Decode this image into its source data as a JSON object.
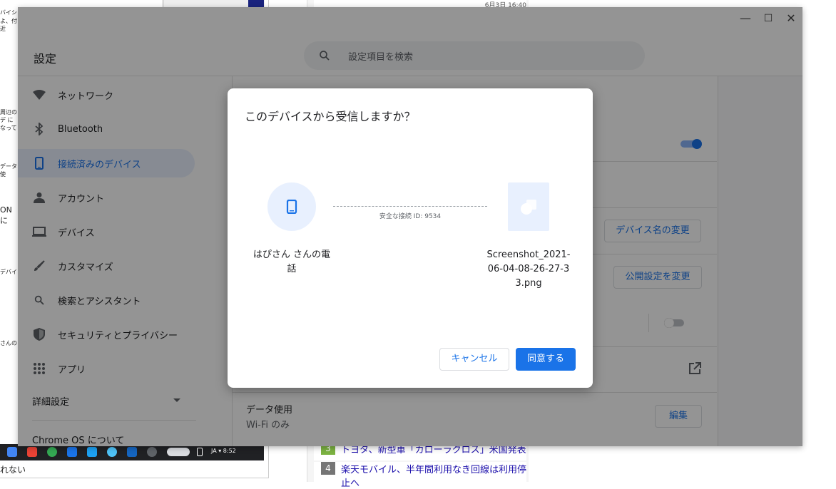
{
  "background": {
    "left_fragments": [
      "バイシ",
      "よ、付近",
      "データ使",
      "ONに",
      "デバイ",
      "さんの",
      "周辺のデ になって"
    ],
    "right_time": "6月3日 16:40",
    "news": [
      {
        "num": "3",
        "text": "トヨタ、新型車「カローラクロス」米国発表"
      },
      {
        "num": "4",
        "text": "楽天モバイル、半年間利用なき回線は利用停止へ"
      }
    ],
    "bottom_text": "れない"
  },
  "window": {
    "minimize_glyph": "—",
    "maximize_glyph": "☐",
    "close_glyph": "✕"
  },
  "header": {
    "title": "設定",
    "search_placeholder": "設定項目を検索"
  },
  "sidebar": {
    "items": [
      {
        "label": "ネットワーク",
        "icon": "wifi-icon"
      },
      {
        "label": "Bluetooth",
        "icon": "bluetooth-icon"
      },
      {
        "label": "接続済みのデバイス",
        "icon": "phone-icon",
        "active": true
      },
      {
        "label": "アカウント",
        "icon": "person-icon"
      },
      {
        "label": "デバイス",
        "icon": "laptop-icon"
      },
      {
        "label": "カスタマイズ",
        "icon": "brush-icon"
      },
      {
        "label": "検索とアシスタント",
        "icon": "search-icon"
      },
      {
        "label": "セキュリティとプライバシー",
        "icon": "shield-icon"
      },
      {
        "label": "アプリ",
        "icon": "apps-grid-icon"
      }
    ],
    "advanced": "詳細設定",
    "about": "Chrome OS について"
  },
  "main": {
    "rename_button": "デバイス名の変更",
    "visibility_button": "公開設定を変更",
    "data_usage_title": "データ使用",
    "data_usage_value": "Wi-Fi のみ",
    "edit_button": "編集"
  },
  "dialog": {
    "title": "このデバイスから受信しますか？",
    "device_name": "はぴさん さんの電話",
    "connection_id": "安全な接続 ID: 9534",
    "file_name": "Screenshot_2021-06-04-08-26-27-33.png",
    "cancel": "キャンセル",
    "accept": "同意する"
  },
  "shelf": {
    "status": "JA ▾ 8:52"
  },
  "colors": {
    "accent": "#1a73e8",
    "active_bg": "#e8f0fe"
  }
}
